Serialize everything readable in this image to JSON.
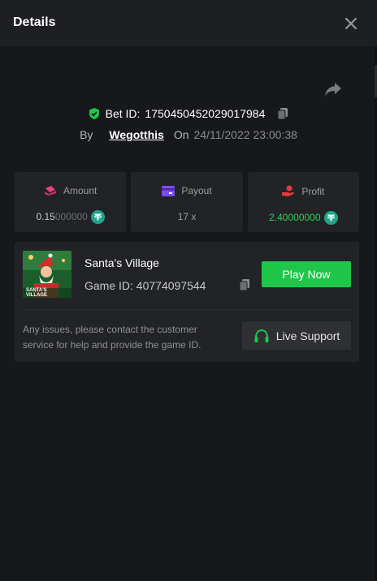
{
  "header": {
    "title": "Details",
    "close_icon": "close-icon"
  },
  "bet": {
    "id_label": "Bet ID:",
    "id_value": "1750450452029017984",
    "by_label": "By",
    "username": "Wegotthis",
    "on_label": "On",
    "datetime": "24/11/2022 23:00:38"
  },
  "stats": {
    "amount": {
      "label": "Amount",
      "value_main": "0.15",
      "value_trail": "000000",
      "currency_icon": "tether-icon"
    },
    "payout": {
      "label": "Payout",
      "value": "17 x"
    },
    "profit": {
      "label": "Profit",
      "value_main": "2.4",
      "value_trail": "0000000",
      "currency_icon": "tether-icon"
    }
  },
  "game": {
    "name": "Santa's Village",
    "id_label": "Game ID:",
    "id_value": "40774097544",
    "play_label": "Play Now",
    "thumbnail_text": "SANTA'S VILLAGE"
  },
  "support": {
    "note": "Any issues, please contact the customer service for help and provide the game ID.",
    "button_label": "Live Support"
  },
  "colors": {
    "background": "#17181b",
    "card": "#222327",
    "accent_green": "#1fc649",
    "amount_icon": "#e8457a",
    "payout_icon": "#7a4cf0",
    "profit_icon": "#e53a3a",
    "tether": "#20a58a"
  }
}
